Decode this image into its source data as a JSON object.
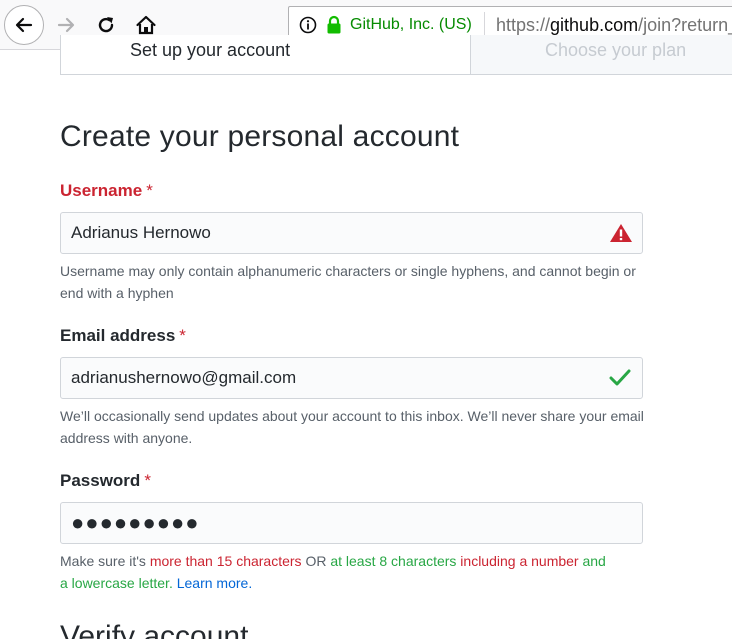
{
  "browser": {
    "identity": "GitHub, Inc. (US)",
    "url_prefix": "https://",
    "url_domain": "github.com",
    "url_path": "/join?return_"
  },
  "steps": {
    "active": "Set up your account",
    "inactive": "Choose your plan"
  },
  "form": {
    "heading": "Create your personal account",
    "required_marker": "*",
    "username": {
      "label": "Username",
      "value": "Adrianus Hernowo",
      "status_icon": "warning-icon",
      "note": "Username may only contain alphanumeric characters or single hyphens, and cannot begin or end with a hyphen"
    },
    "email": {
      "label": "Email address",
      "value": "adrianushernowo@gmail.com",
      "status_icon": "check-icon",
      "note": "We’ll occasionally send updates about your account to this inbox. We’ll never share your email address with anyone."
    },
    "password": {
      "label": "Password",
      "value": "●●●●●●●●●",
      "note_parts": {
        "p1": "Make sure it's ",
        "p2": "more than 15 characters",
        "p3": " OR ",
        "p4": "at least 8 characters",
        "p5": " ",
        "p6": "including a number",
        "p7": " and",
        "p8": "a lowercase letter",
        "p9": ". ",
        "link": "Learn more",
        "p10": "."
      }
    },
    "next_heading": "Verify account"
  },
  "colors": {
    "error": "#cb2431",
    "success": "#28a745",
    "link": "#0366d6",
    "secure": "#058b00"
  }
}
